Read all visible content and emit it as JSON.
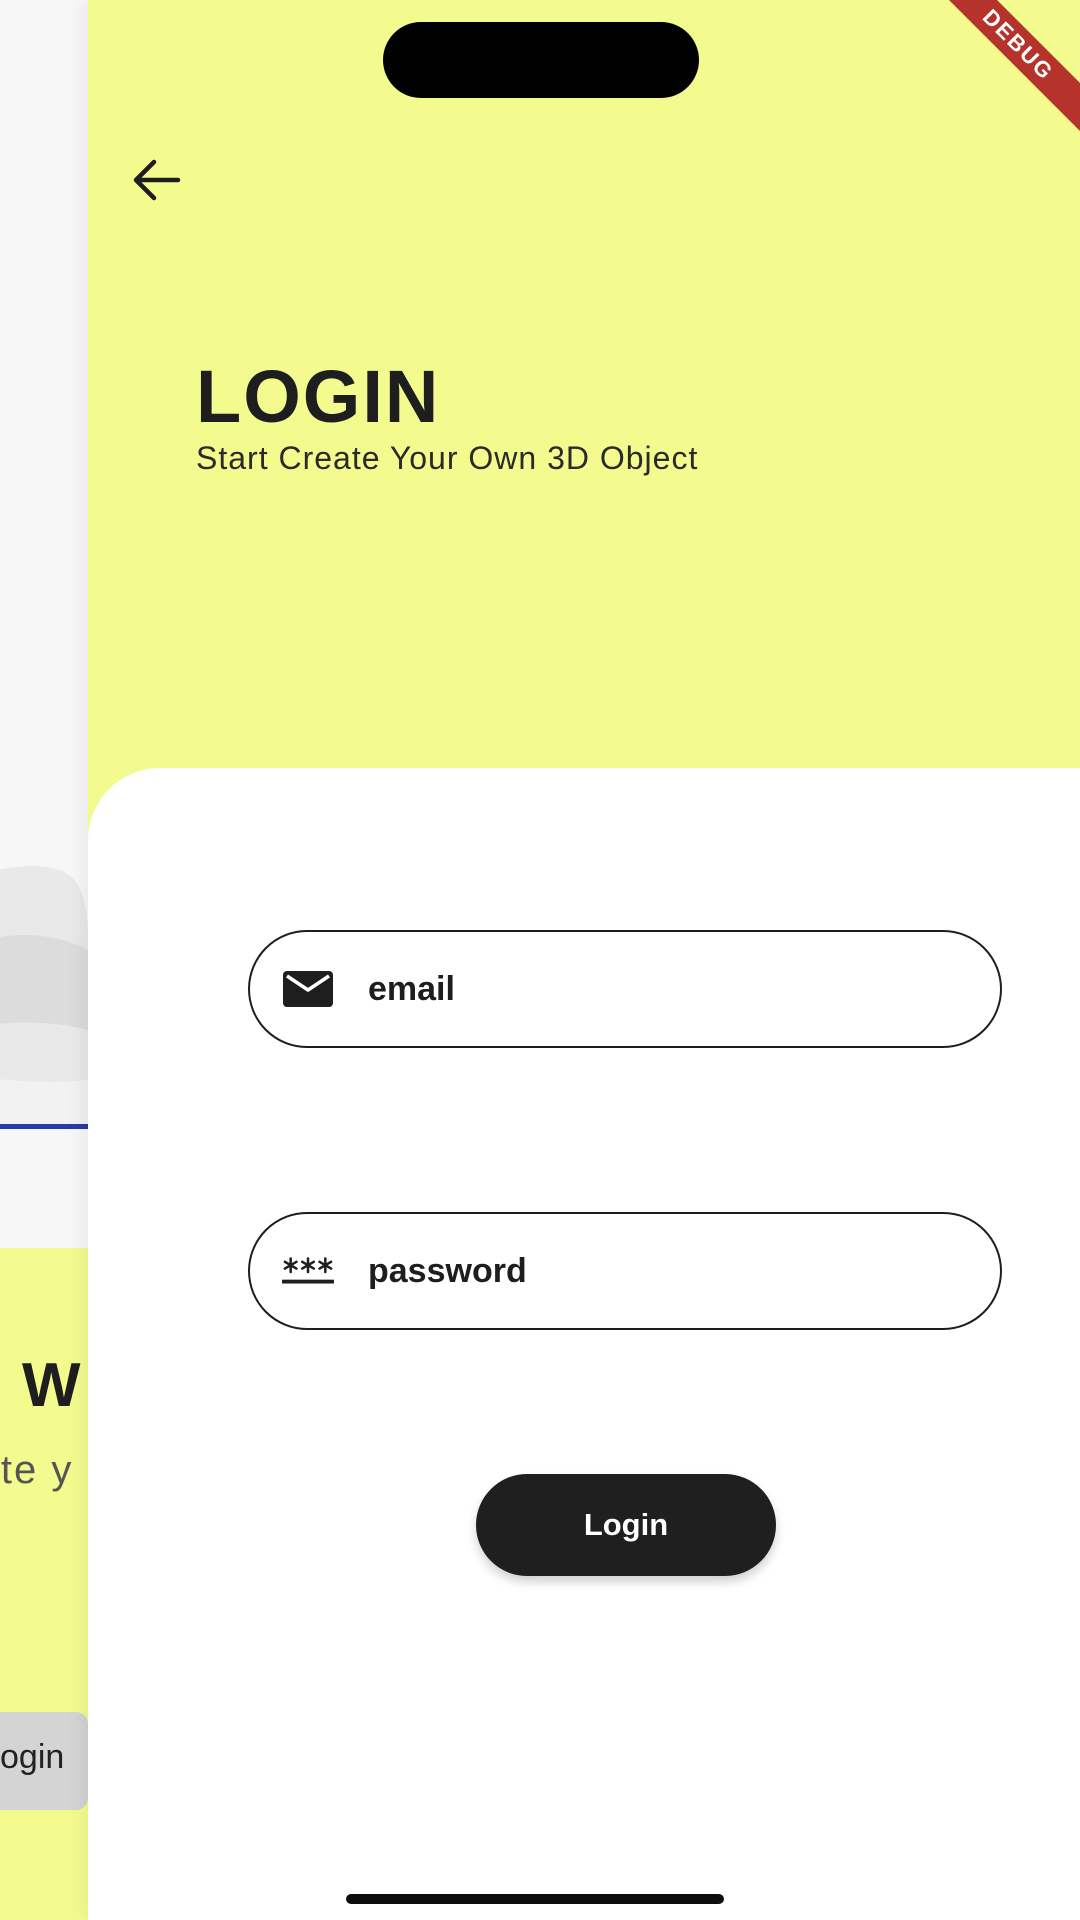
{
  "debug_banner": "DEBUG",
  "background_page": {
    "heading_fragment": "W",
    "subtitle_fragment": "ite y",
    "button_fragment": "ogin"
  },
  "login": {
    "title": "LOGIN",
    "subtitle": "Start Create Your Own 3D Object",
    "email": {
      "placeholder": "email",
      "value": "",
      "icon": "mail-icon"
    },
    "password": {
      "placeholder": "password",
      "value": "",
      "icon": "password-icon"
    },
    "submit_label": "Login"
  },
  "colors": {
    "accent_yellow": "#f4fb8e",
    "button_dark": "#1f1f1f",
    "debug_red": "#b6332c"
  }
}
